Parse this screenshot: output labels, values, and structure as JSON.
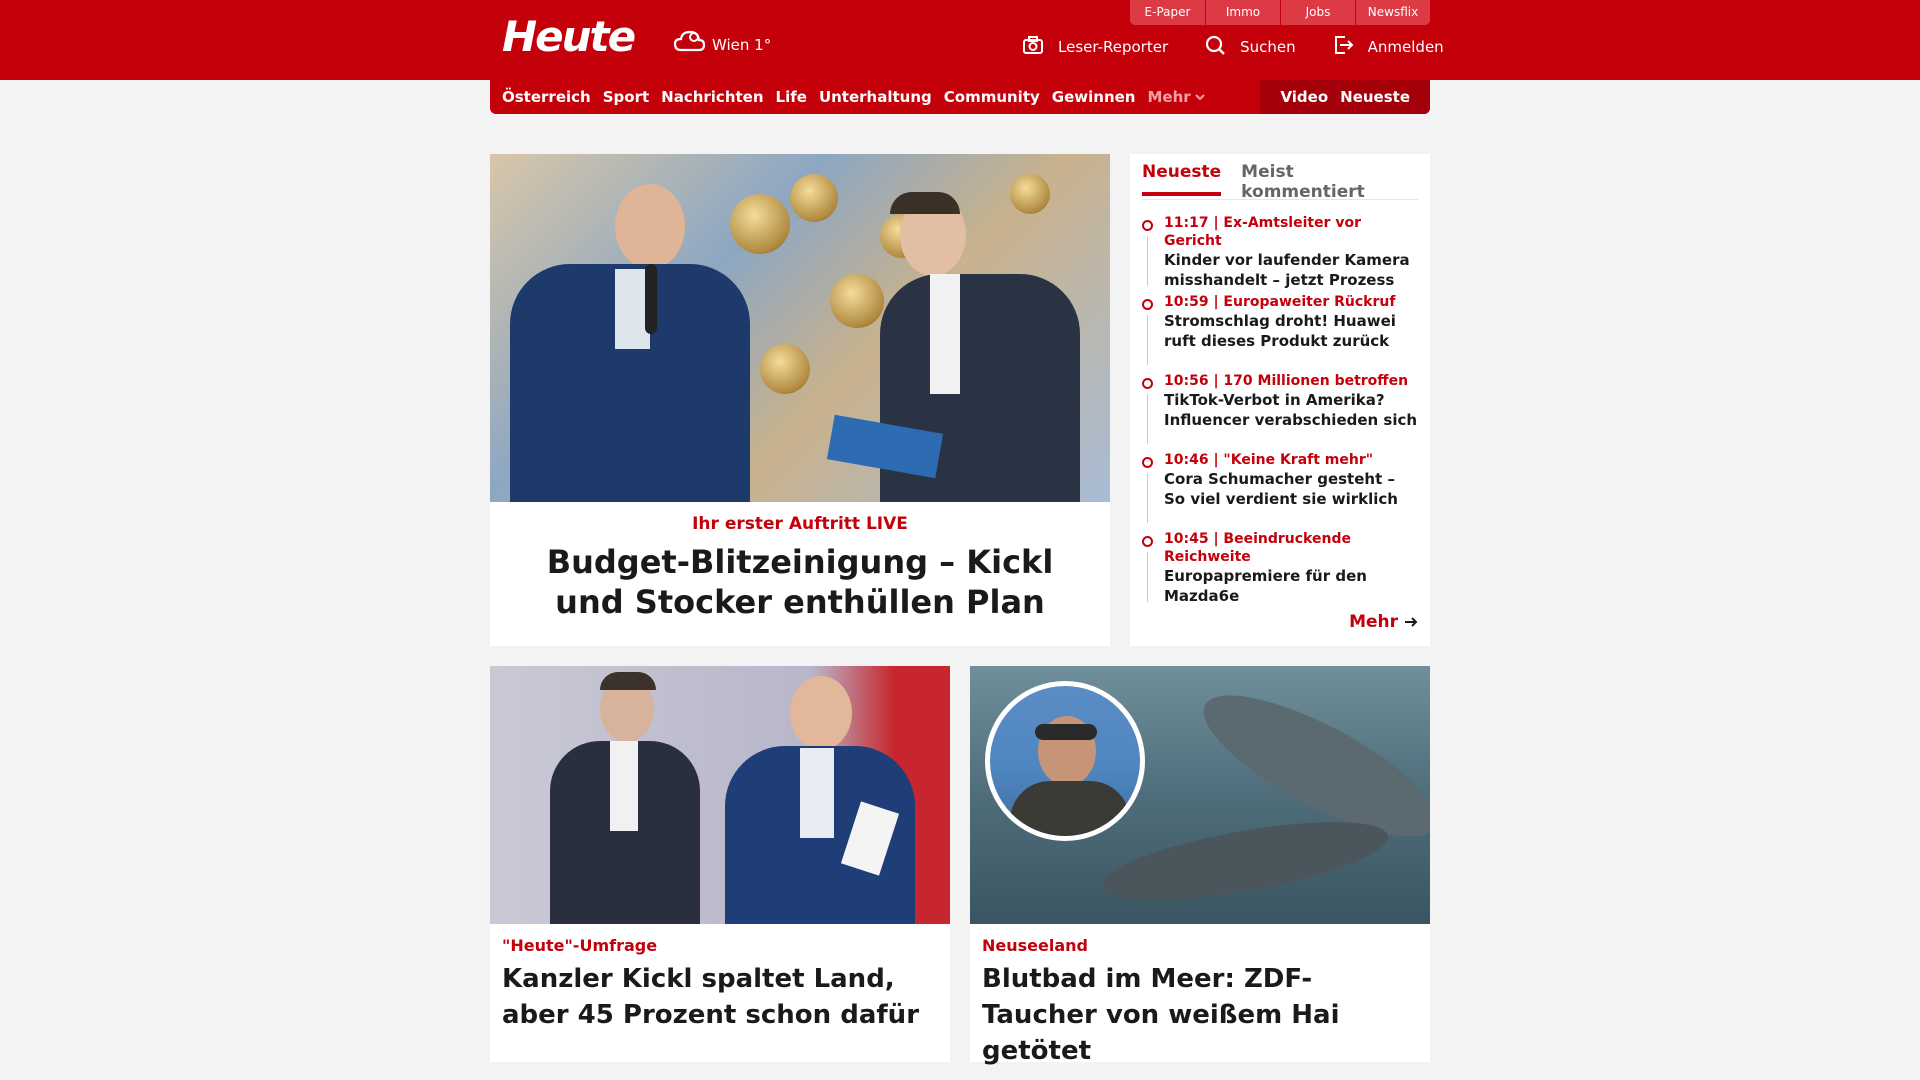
{
  "header": {
    "logo": "Heute",
    "weather": "Wien 1°",
    "service_tabs": [
      "E-Paper",
      "Immo",
      "Jobs",
      "Newsflix"
    ],
    "actions": [
      {
        "label": "Leser-Reporter",
        "icon": "camera-icon"
      },
      {
        "label": "Suchen",
        "icon": "search-icon"
      },
      {
        "label": "Anmelden",
        "icon": "login-icon"
      }
    ]
  },
  "nav": {
    "items": [
      "Österreich",
      "Sport",
      "Nachrichten",
      "Life",
      "Unterhaltung",
      "Community",
      "Gewinnen"
    ],
    "more": "Mehr",
    "right": [
      "Video",
      "Neueste"
    ]
  },
  "hero": {
    "kicker": "Ihr erster Auftritt LIVE",
    "title": "Budget-Blitzeinigung – Kickl und Stocker enthüllen Plan"
  },
  "sidebar": {
    "tabs": [
      "Neueste",
      "Meist kommentiert"
    ],
    "items": [
      {
        "meta": "11:17 | Ex-Amtsleiter vor Gericht",
        "title": "Kinder vor laufender Kamera misshandelt – jetzt Prozess"
      },
      {
        "meta": "10:59 | Europaweiter Rückruf",
        "title": "Stromschlag droht! Huawei ruft dieses Produkt zurück"
      },
      {
        "meta": "10:56 | 170 Millionen betroffen",
        "title": "TikTok-Verbot in Amerika? Influencer verabschieden sich"
      },
      {
        "meta": "10:46 | \"Keine Kraft mehr\"",
        "title": "Cora Schumacher gesteht – So viel verdient sie wirklich"
      },
      {
        "meta": "10:45 | Beeindruckende Reichweite",
        "title": "Europapremiere für den Mazda6e"
      }
    ],
    "more": "Mehr"
  },
  "cards": [
    {
      "kicker": "\"Heute\"-Umfrage",
      "title": "Kanzler Kickl spaltet Land, aber 45 Prozent schon dafür"
    },
    {
      "kicker": "Neuseeland",
      "title": "Blutbad im Meer: ZDF-Taucher von weißem Hai getötet"
    }
  ]
}
